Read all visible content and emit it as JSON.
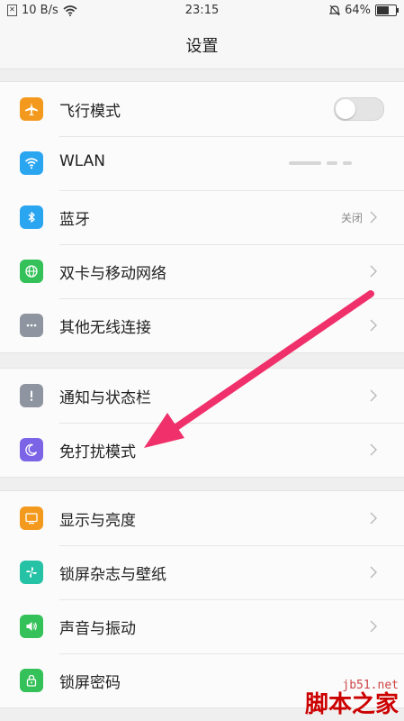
{
  "status_bar": {
    "network_speed": "10 B/s",
    "time": "23:15",
    "battery": "64%",
    "battery_level": 0.64
  },
  "header": {
    "title": "设置"
  },
  "groups": [
    {
      "items": [
        {
          "label": "飞行模式",
          "icon": "airplane-icon",
          "icon_color": "#f39a1e",
          "control": "toggle",
          "toggle_on": false
        },
        {
          "label": "WLAN",
          "icon": "wifi-icon",
          "icon_color": "#2aa5f0"
        },
        {
          "label": "蓝牙",
          "icon": "bluetooth-icon",
          "icon_color": "#2aa5f0",
          "value": "关闭"
        },
        {
          "label": "双卡与移动网络",
          "icon": "globe-icon",
          "icon_color": "#35c15a"
        },
        {
          "label": "其他无线连接",
          "icon": "more-dots-icon",
          "icon_color": "#8f95a0"
        }
      ]
    },
    {
      "items": [
        {
          "label": "通知与状态栏",
          "icon": "exclamation-icon",
          "icon_color": "#8f95a0"
        },
        {
          "label": "免打扰模式",
          "icon": "moon-icon",
          "icon_color": "#7c64e6"
        }
      ]
    },
    {
      "items": [
        {
          "label": "显示与亮度",
          "icon": "display-icon",
          "icon_color": "#f39a1e"
        },
        {
          "label": "锁屏杂志与壁纸",
          "icon": "pinwheel-icon",
          "icon_color": "#25c2a6"
        },
        {
          "label": "声音与振动",
          "icon": "speaker-icon",
          "icon_color": "#35c15a"
        },
        {
          "label": "锁屏密码",
          "icon": "lock-icon",
          "icon_color": "#35c15a"
        }
      ]
    }
  ],
  "annotation": {
    "arrow_color": "#f0306a"
  },
  "watermark": {
    "url": "jb51.net",
    "brand": "脚本之家"
  }
}
